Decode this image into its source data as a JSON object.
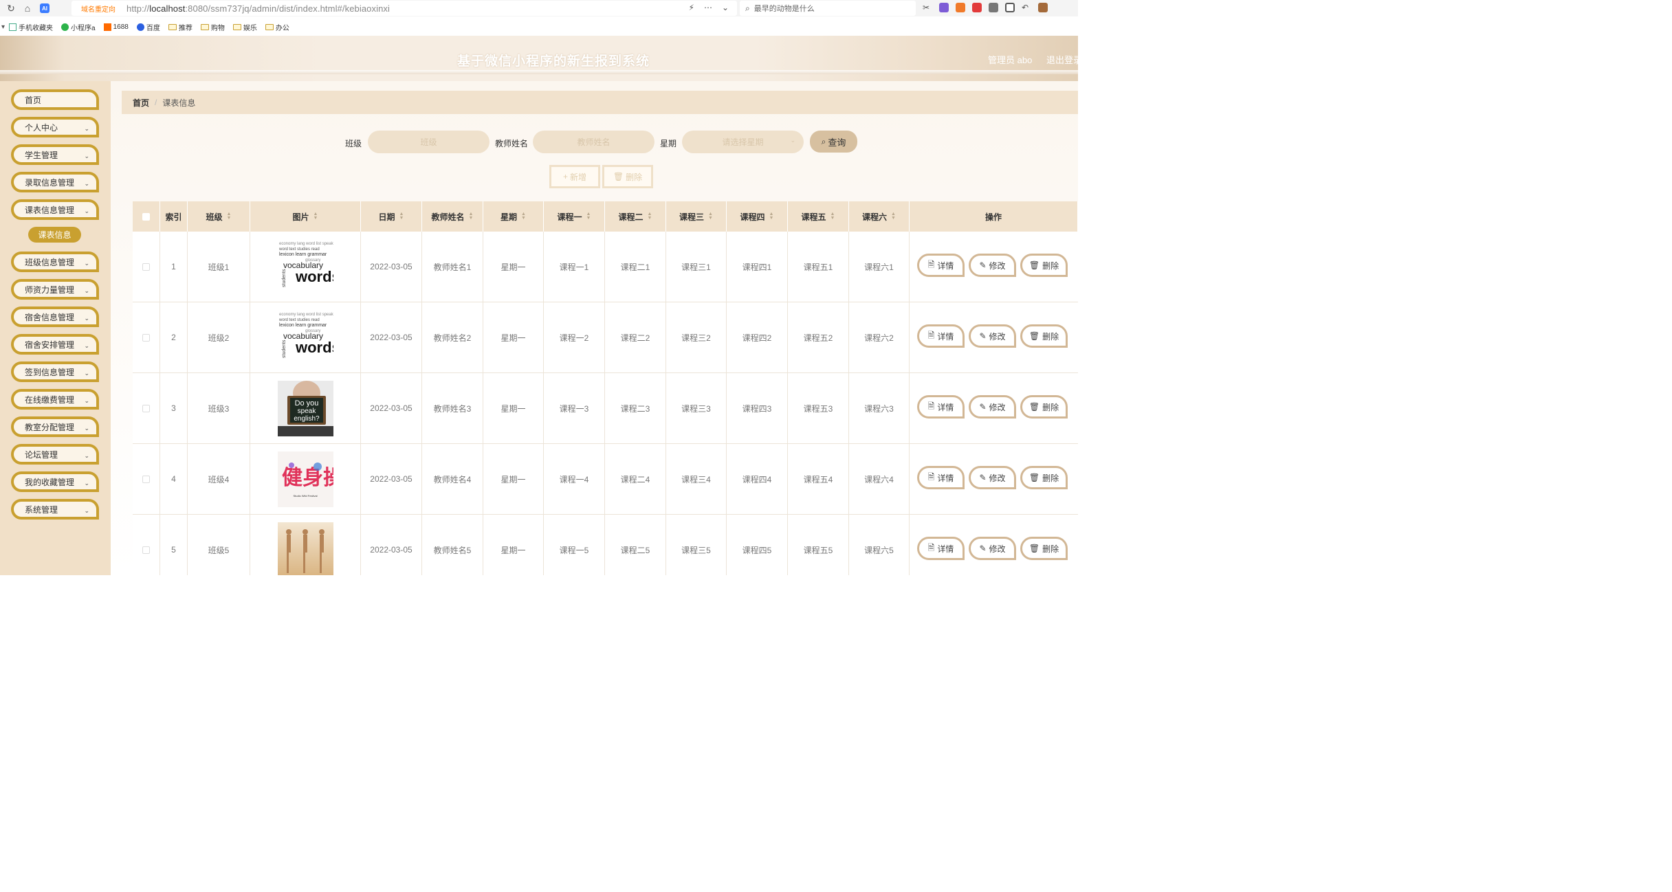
{
  "browser": {
    "redirect_tag": "域名重定向",
    "url_prefix": "http://",
    "url_host": "localhost",
    "url_rest": ":8080/ssm737jq/admin/dist/index.html#/kebiaoxinxi",
    "search_placeholder": "最早的动物是什么",
    "bookmarks": [
      "手机收藏夹",
      "小程序a",
      "1688",
      "百度",
      "推荐",
      "购物",
      "娱乐",
      "办公"
    ]
  },
  "header": {
    "title": "基于微信小程序的新生报到系统",
    "user": "管理员 abo",
    "logout": "退出登录"
  },
  "sidebar": {
    "items": [
      {
        "label": "首页",
        "has_chevron": false
      },
      {
        "label": "个人中心",
        "has_chevron": true
      },
      {
        "label": "学生管理",
        "has_chevron": true
      },
      {
        "label": "录取信息管理",
        "has_chevron": true
      },
      {
        "label": "课表信息管理",
        "has_chevron": true
      },
      {
        "label": "班级信息管理",
        "has_chevron": true
      },
      {
        "label": "师资力量管理",
        "has_chevron": true
      },
      {
        "label": "宿舍信息管理",
        "has_chevron": true
      },
      {
        "label": "宿舍安排管理",
        "has_chevron": true
      },
      {
        "label": "签到信息管理",
        "has_chevron": true
      },
      {
        "label": "在线缴费管理",
        "has_chevron": true
      },
      {
        "label": "教室分配管理",
        "has_chevron": true
      },
      {
        "label": "论坛管理",
        "has_chevron": true
      },
      {
        "label": "我的收藏管理",
        "has_chevron": true
      },
      {
        "label": "系统管理",
        "has_chevron": true
      }
    ],
    "active_sub": "课表信息"
  },
  "breadcrumb": {
    "home": "首页",
    "sep": "/",
    "current": "课表信息"
  },
  "filters": {
    "class_label": "班级",
    "class_placeholder": "班级",
    "teacher_label": "教师姓名",
    "teacher_placeholder": "教师姓名",
    "weekday_label": "星期",
    "weekday_placeholder": "请选择星期",
    "query": "查询",
    "add": "新增",
    "delete": "删除"
  },
  "table": {
    "columns": [
      "索引",
      "班级",
      "图片",
      "日期",
      "教师姓名",
      "星期",
      "课程一",
      "课程二",
      "课程三",
      "课程四",
      "课程五",
      "课程六",
      "操作"
    ],
    "rows": [
      {
        "index": "1",
        "class": "班级1",
        "image": "vocabulary-words",
        "date": "2022-03-05",
        "teacher": "教师姓名1",
        "weekday": "星期一",
        "c1": "课程一1",
        "c2": "课程二1",
        "c3": "课程三1",
        "c4": "课程四1",
        "c5": "课程五1",
        "c6": "课程六1"
      },
      {
        "index": "2",
        "class": "班级2",
        "image": "vocabulary-words",
        "date": "2022-03-05",
        "teacher": "教师姓名2",
        "weekday": "星期一",
        "c1": "课程一2",
        "c2": "课程二2",
        "c3": "课程三2",
        "c4": "课程四2",
        "c5": "课程五2",
        "c6": "课程六2"
      },
      {
        "index": "3",
        "class": "班级3",
        "image": "do-you-speak-english",
        "date": "2022-03-05",
        "teacher": "教师姓名3",
        "weekday": "星期一",
        "c1": "课程一3",
        "c2": "课程二3",
        "c3": "课程三3",
        "c4": "课程四3",
        "c5": "课程五3",
        "c6": "课程六3"
      },
      {
        "index": "4",
        "class": "班级4",
        "image": "health-exercise-poster",
        "date": "2022-03-05",
        "teacher": "教师姓名4",
        "weekday": "星期一",
        "c1": "课程一4",
        "c2": "课程二4",
        "c3": "课程三4",
        "c4": "课程四4",
        "c5": "课程五4",
        "c6": "课程六4"
      },
      {
        "index": "5",
        "class": "班级5",
        "image": "dancers-photo",
        "date": "2022-03-05",
        "teacher": "教师姓名5",
        "weekday": "星期一",
        "c1": "课程一5",
        "c2": "课程二5",
        "c3": "课程三5",
        "c4": "课程四5",
        "c5": "课程五5",
        "c6": "课程六5"
      }
    ],
    "actions": {
      "detail": "详情",
      "edit": "修改",
      "delete": "删除"
    }
  },
  "image_text": {
    "vocab_small": "students",
    "vocab_mid": "vocabulary",
    "vocab_big": "words",
    "english_1": "Do you",
    "english_2": "speak",
    "english_3": "english?",
    "poster_title": "健身操",
    "poster_sub": "Studio Wild Festival"
  },
  "colors": {
    "accent": "#c9a030",
    "sidebar_bg": "#f1e0c8",
    "header_bg": "#f1e2cd",
    "op_border": "#d2b795"
  }
}
